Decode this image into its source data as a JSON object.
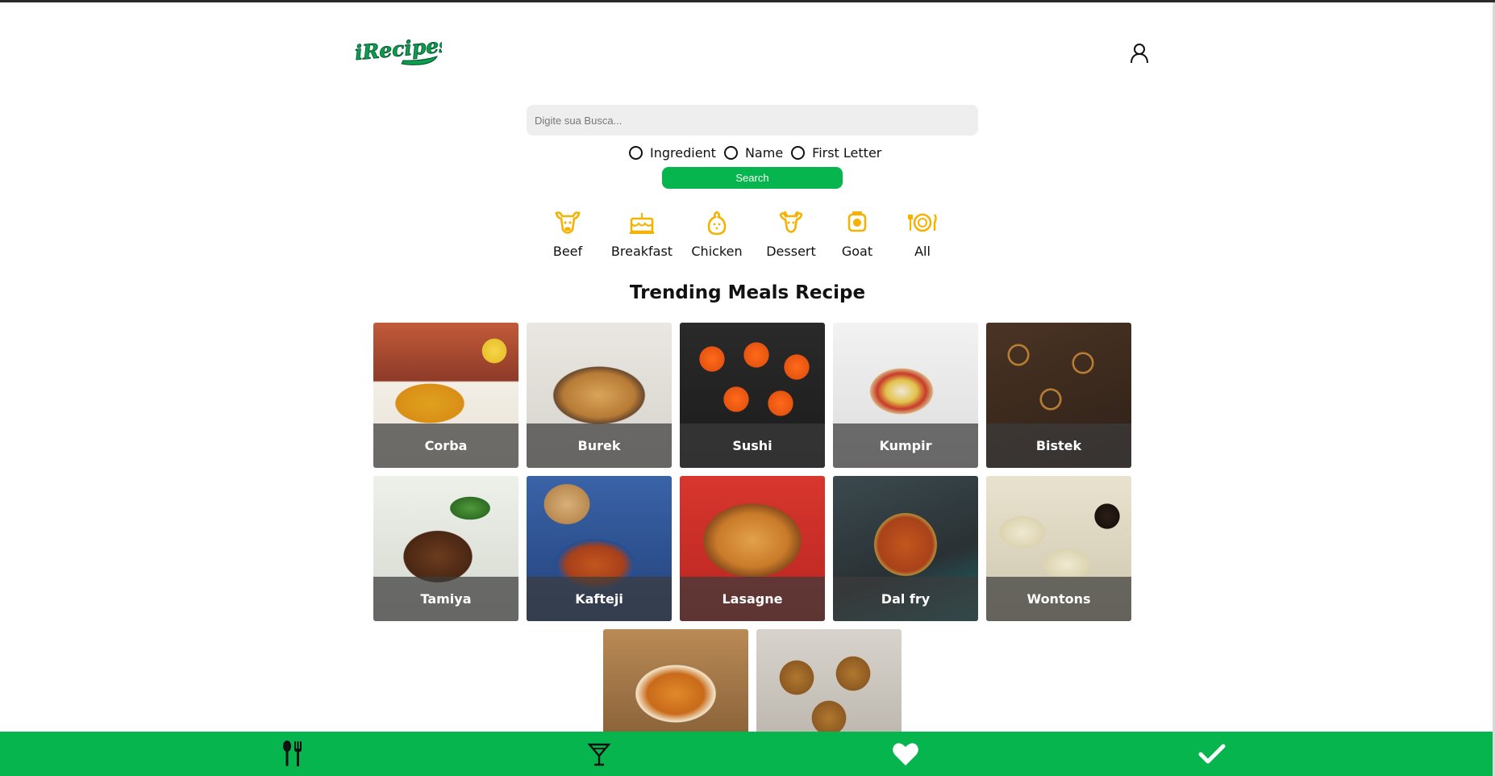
{
  "app": {
    "logo_text": "iRecipes"
  },
  "search": {
    "placeholder": "Digite sua Busca...",
    "value": "",
    "options": [
      "Ingredient",
      "Name",
      "First Letter"
    ],
    "button_label": "Search"
  },
  "categories": [
    {
      "label": "Beef",
      "icon": "cow-icon"
    },
    {
      "label": "Breakfast",
      "icon": "cake-icon"
    },
    {
      "label": "Chicken",
      "icon": "chicken-icon"
    },
    {
      "label": "Dessert",
      "icon": "cupcake-icon"
    },
    {
      "label": "Goat",
      "icon": "goat-icon"
    },
    {
      "label": "All",
      "icon": "plate-icon"
    }
  ],
  "section": {
    "title": "Trending Meals Recipe"
  },
  "meals": [
    {
      "name": "Corba"
    },
    {
      "name": "Burek"
    },
    {
      "name": "Sushi"
    },
    {
      "name": "Kumpir"
    },
    {
      "name": "Bistek"
    },
    {
      "name": "Tamiya"
    },
    {
      "name": "Kafteji"
    },
    {
      "name": "Lasagne"
    },
    {
      "name": "Dal fry"
    },
    {
      "name": "Wontons"
    },
    {
      "name": ""
    },
    {
      "name": ""
    }
  ],
  "footer": {
    "items": [
      {
        "icon": "fork-knife-icon"
      },
      {
        "icon": "cocktail-icon"
      },
      {
        "icon": "heart-icon"
      },
      {
        "icon": "check-icon"
      }
    ]
  },
  "colors": {
    "brand_green": "#06b54e",
    "category_icon": "#f5b301"
  }
}
